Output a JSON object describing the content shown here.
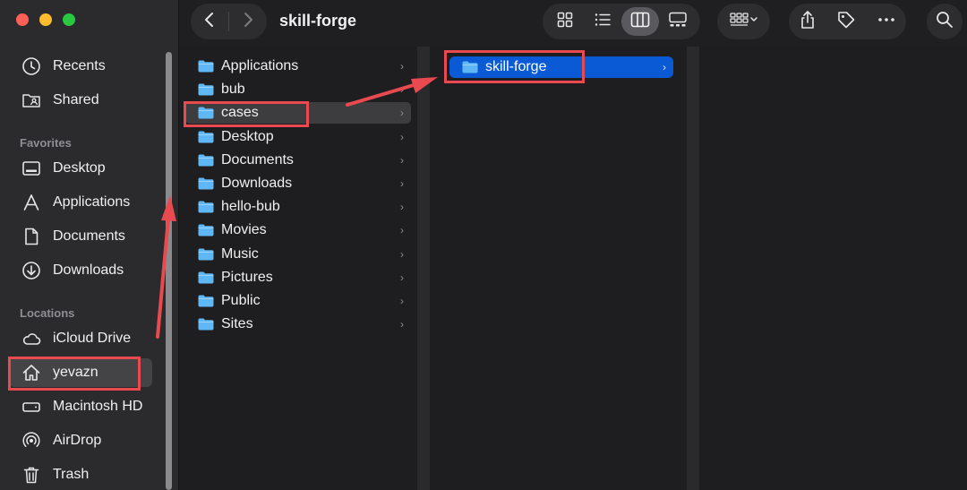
{
  "window": {
    "title": "skill-forge"
  },
  "sidebar": {
    "items_top": [
      {
        "label": "Recents",
        "icon": "clock-icon"
      },
      {
        "label": "Shared",
        "icon": "shared-folder-icon"
      }
    ],
    "favorites_heading": "Favorites",
    "favorites": [
      {
        "label": "Desktop",
        "icon": "desktop-icon"
      },
      {
        "label": "Applications",
        "icon": "applications-icon"
      },
      {
        "label": "Documents",
        "icon": "document-icon"
      },
      {
        "label": "Downloads",
        "icon": "download-icon"
      }
    ],
    "locations_heading": "Locations",
    "locations": [
      {
        "label": "iCloud Drive",
        "icon": "cloud-icon"
      },
      {
        "label": "yevazn",
        "icon": "home-icon",
        "selected": true
      },
      {
        "label": "Macintosh HD",
        "icon": "disk-icon"
      },
      {
        "label": "AirDrop",
        "icon": "airdrop-icon"
      },
      {
        "label": "Trash",
        "icon": "trash-icon"
      }
    ]
  },
  "column1": {
    "items": [
      "Applications",
      "bub",
      "cases",
      "Desktop",
      "Documents",
      "Downloads",
      "hello-bub",
      "Movies",
      "Music",
      "Pictures",
      "Public",
      "Sites"
    ],
    "selected": "cases"
  },
  "column2": {
    "items": [
      "skill-forge"
    ],
    "selected": "skill-forge"
  },
  "colors": {
    "selection_blue": "#0a5ad6",
    "annotation_red": "#e84a4f",
    "folder_blue": "#5fb8f5"
  }
}
